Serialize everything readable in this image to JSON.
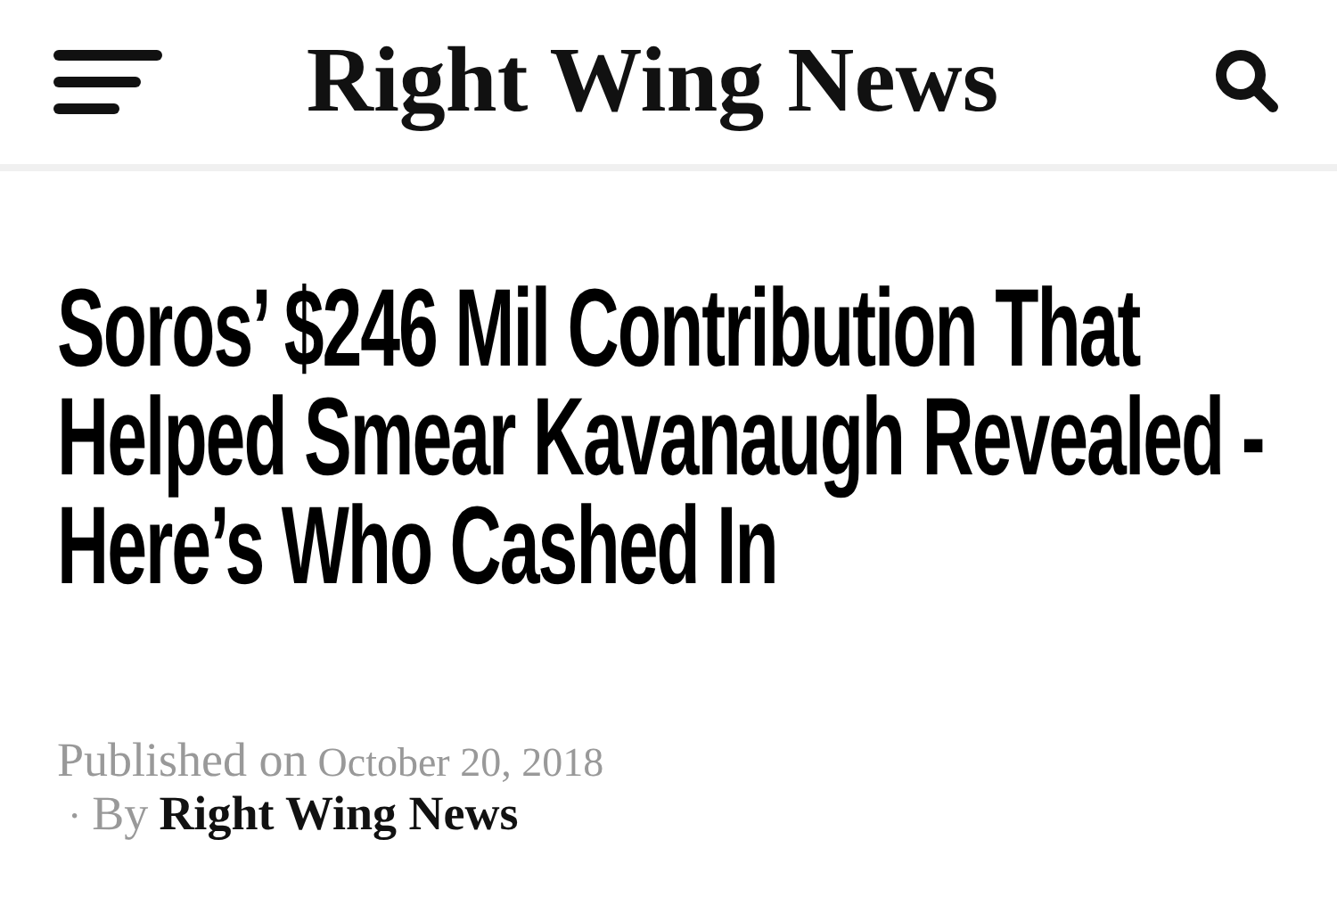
{
  "header": {
    "site_title": "Right Wing News"
  },
  "article": {
    "headline": "Soros’ $246 Mil Contribution That Helped Smear Kavanaugh Revealed - Here’s Who Cashed In",
    "published_label": "Published on",
    "date": "October 20, 2018",
    "separator": "·",
    "by_label": "By",
    "author": "Right Wing News"
  }
}
